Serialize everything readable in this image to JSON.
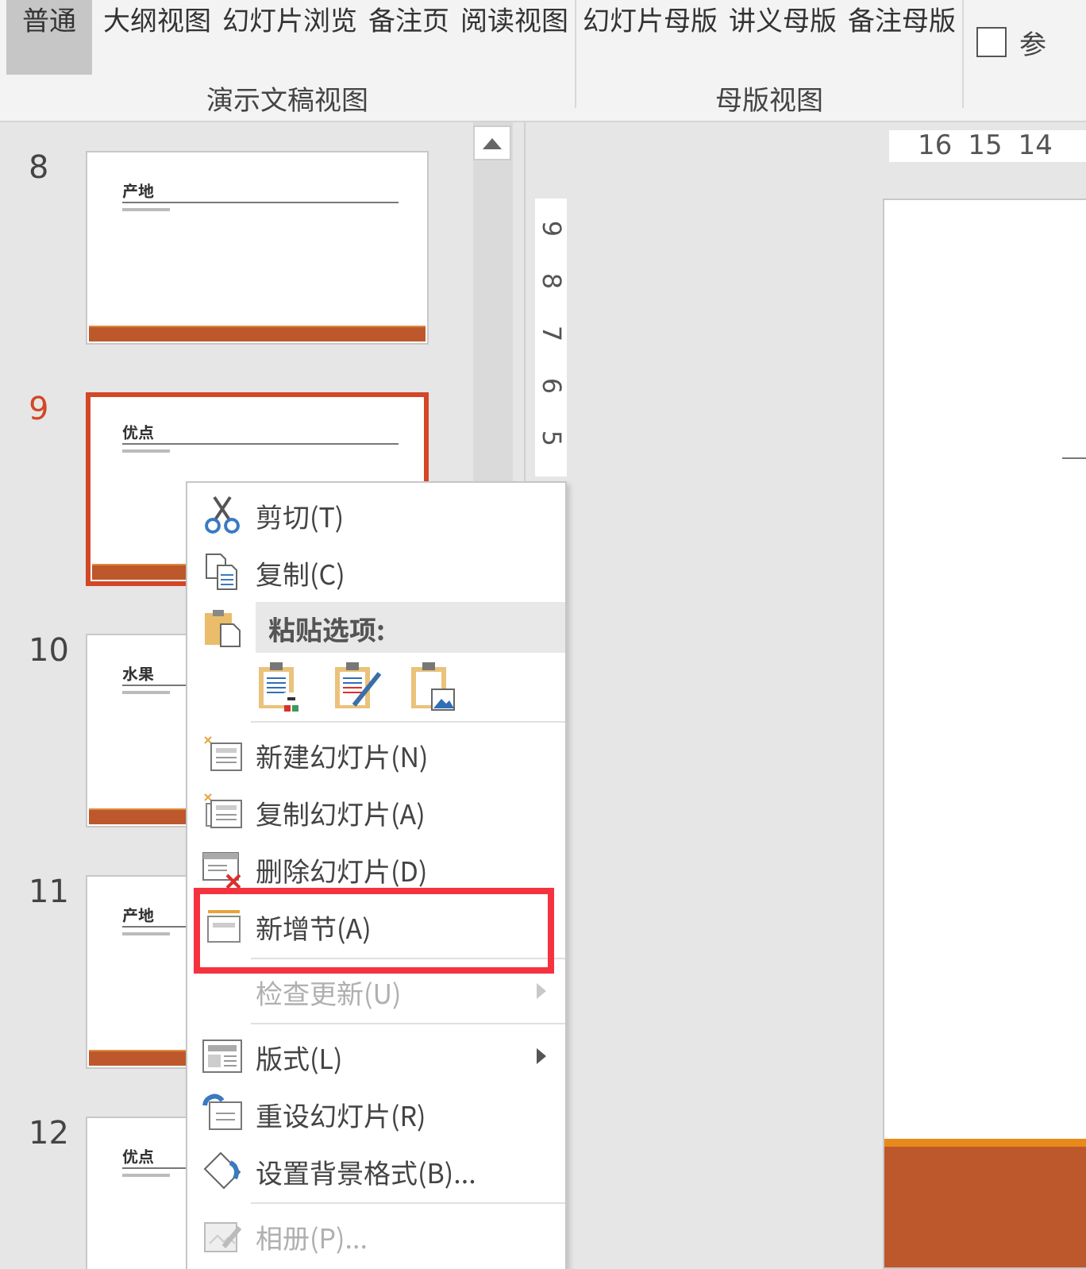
{
  "ribbon": {
    "groups": [
      {
        "label": "演示文稿视图",
        "buttons": [
          {
            "label": "普通",
            "selected": true
          },
          {
            "label": "大纲视图",
            "selected": false
          },
          {
            "label": "幻灯片浏览",
            "selected": false
          },
          {
            "label": "备注页",
            "selected": false
          },
          {
            "label": "阅读视图",
            "selected": false
          }
        ]
      },
      {
        "label": "母版视图",
        "buttons": [
          {
            "label": "幻灯片母版",
            "selected": false
          },
          {
            "label": "讲义母版",
            "selected": false
          },
          {
            "label": "备注母版",
            "selected": false
          }
        ]
      }
    ],
    "checkboxes": [
      {
        "label": "参",
        "checked": false
      }
    ]
  },
  "slides": [
    {
      "number": "8",
      "title": "产地",
      "selected": false
    },
    {
      "number": "9",
      "title": "优点",
      "selected": true
    },
    {
      "number": "10",
      "title": "水果",
      "selected": false
    },
    {
      "number": "11",
      "title": "产地",
      "selected": false
    },
    {
      "number": "12",
      "title": "优点",
      "selected": false
    }
  ],
  "rulers": {
    "horizontal": [
      "16",
      "15",
      "14"
    ],
    "vertical": [
      "9",
      "8",
      "7",
      "6",
      "5"
    ]
  },
  "context_menu": {
    "items": [
      {
        "kind": "item",
        "label": "剪切(T)",
        "disabled": false,
        "submenu": false,
        "highlighted": false
      },
      {
        "kind": "item",
        "label": "复制(C)",
        "disabled": false,
        "submenu": false,
        "highlighted": false
      },
      {
        "kind": "header",
        "label": "粘贴选项:"
      },
      {
        "kind": "paste_options"
      },
      {
        "kind": "separator"
      },
      {
        "kind": "item",
        "label": "新建幻灯片(N)",
        "disabled": false,
        "submenu": false,
        "highlighted": false
      },
      {
        "kind": "item",
        "label": "复制幻灯片(A)",
        "disabled": false,
        "submenu": false,
        "highlighted": false
      },
      {
        "kind": "item",
        "label": "删除幻灯片(D)",
        "disabled": false,
        "submenu": false,
        "highlighted": false
      },
      {
        "kind": "item",
        "label": "新增节(A)",
        "disabled": false,
        "submenu": false,
        "highlighted": true
      },
      {
        "kind": "separator"
      },
      {
        "kind": "item",
        "label": "检查更新(U)",
        "disabled": true,
        "submenu": true,
        "highlighted": false
      },
      {
        "kind": "separator"
      },
      {
        "kind": "item",
        "label": "版式(L)",
        "disabled": false,
        "submenu": true,
        "highlighted": false
      },
      {
        "kind": "item",
        "label": "重设幻灯片(R)",
        "disabled": false,
        "submenu": false,
        "highlighted": false
      },
      {
        "kind": "item",
        "label": "设置背景格式(B)...",
        "disabled": false,
        "submenu": false,
        "highlighted": false
      },
      {
        "kind": "separator"
      },
      {
        "kind": "item",
        "label": "相册(P)...",
        "disabled": true,
        "submenu": false,
        "highlighted": false
      }
    ]
  }
}
